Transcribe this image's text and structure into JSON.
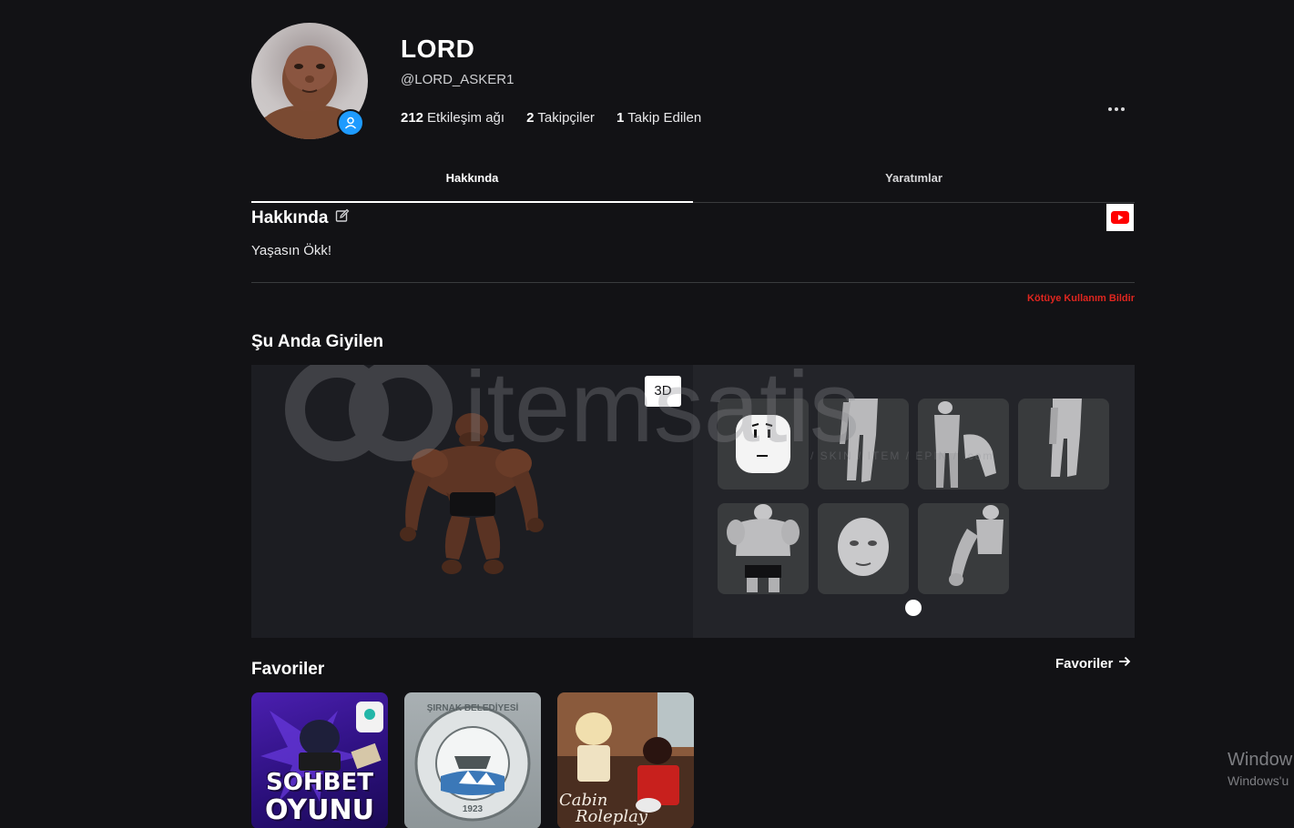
{
  "profile": {
    "display_name": "LORD",
    "username": "@LORD_ASKER1",
    "stats": [
      {
        "count": "212",
        "label": "Etkileşim ağı"
      },
      {
        "count": "2",
        "label": "Takipçiler"
      },
      {
        "count": "1",
        "label": "Takip Edilen"
      }
    ],
    "more_icon": "more-horizontal-icon",
    "presence_icon": "online-user-icon",
    "presence_color": "#1e9bff"
  },
  "tabs": [
    {
      "label": "Hakkında",
      "active": true
    },
    {
      "label": "Yaratımlar",
      "active": false
    }
  ],
  "about": {
    "title": "Hakkında",
    "edit_icon": "edit-icon",
    "text": "Yaşasın Ökk!",
    "social_icon": "youtube-icon",
    "report_label": "Kötüye Kullanım Bildir",
    "report_color": "#e0261f"
  },
  "wearing": {
    "title": "Şu Anda Giyilen",
    "toggle_label": "3D",
    "items": [
      {
        "name": "classic-face"
      },
      {
        "name": "legs-package"
      },
      {
        "name": "torso-package"
      },
      {
        "name": "right-leg"
      },
      {
        "name": "muscle-torso-shorts"
      },
      {
        "name": "bald-head"
      },
      {
        "name": "left-arm"
      }
    ],
    "page_count": 1,
    "watermark_text": "itemsatis",
    "watermark_sub": "/ SKIN / ITEM / EPIN / .com"
  },
  "favorites": {
    "title": "Favoriler",
    "link_label": "Favoriler",
    "link_icon": "arrow-right-icon",
    "games": [
      {
        "line1": "SOHBET",
        "line2": "OYUNU"
      },
      {
        "seal_top": "ŞIRNAK BELEDİYESİ",
        "seal_year": "1923"
      },
      {
        "line1": "Cabin",
        "line2": "Roleplay"
      }
    ]
  },
  "os_overlay": {
    "line1": "Window",
    "line2": "Windows'u"
  }
}
